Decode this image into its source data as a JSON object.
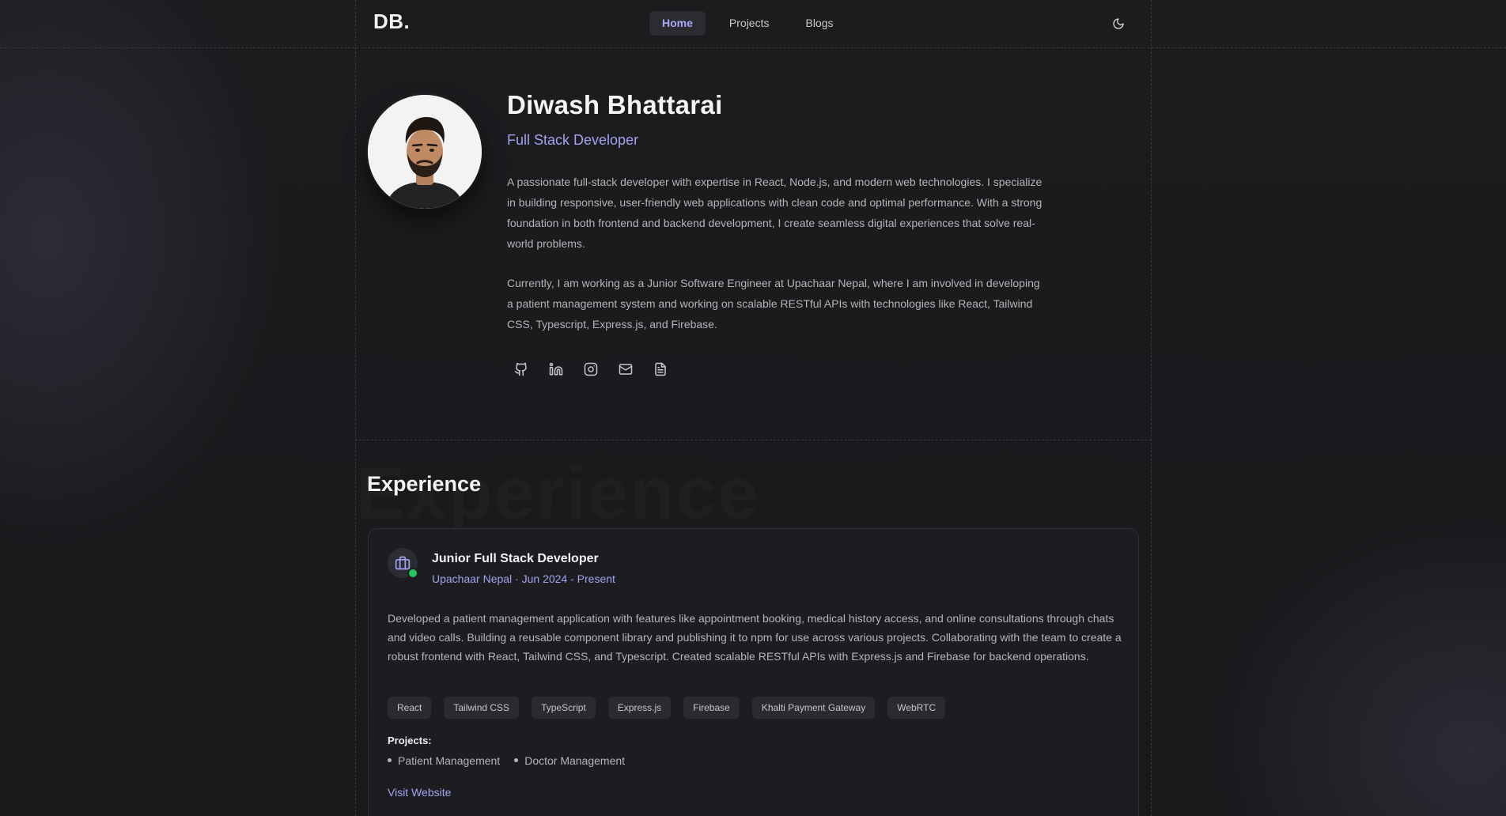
{
  "header": {
    "logo": "DB.",
    "nav": [
      {
        "label": "Home",
        "active": true
      },
      {
        "label": "Projects",
        "active": false
      },
      {
        "label": "Blogs",
        "active": false
      }
    ],
    "theme_toggle_icon": "moon-icon"
  },
  "hero": {
    "name": "Diwash Bhattarai",
    "role": "Full Stack Developer",
    "bio": [
      "A passionate full-stack developer with expertise in React, Node.js, and modern web technologies. I specialize in building responsive, user-friendly web applications with clean code and optimal performance. With a strong foundation in both frontend and backend development, I create seamless digital experiences that solve real-world problems.",
      "Currently, I am working as a Junior Software Engineer at Upachaar Nepal, where I am involved in developing a patient management system and working on scalable RESTful APIs with technologies like React, Tailwind CSS, Typescript, Express.js, and Firebase."
    ],
    "socials": [
      "github-icon",
      "linkedin-icon",
      "instagram-icon",
      "mail-icon",
      "resume-icon"
    ]
  },
  "experience": {
    "title": "Experience",
    "ghost_text": "Experience",
    "job": {
      "title": "Junior Full Stack Developer",
      "meta": "Upachaar Nepal · Jun 2024 - Present",
      "description": "Developed a patient management application with features like appointment booking, medical history access, and online consultations through chats and video calls. Building a reusable component library and publishing it to npm for use across various projects. Collaborating with the team to create a robust frontend with React, Tailwind CSS, and Typescript. Created scalable RESTful APIs with Express.js and Firebase for backend operations.",
      "tags": [
        "React",
        "Tailwind CSS",
        "TypeScript",
        "Express.js",
        "Firebase",
        "Khalti Payment Gateway",
        "WebRTC"
      ],
      "projects_label": "Projects:",
      "projects": [
        "Patient Management",
        "Doctor Management"
      ],
      "link_label": "Visit Website"
    }
  },
  "colors": {
    "accent": "#a3a2f2",
    "background": "#1b1b1e",
    "status": "#22c55e"
  }
}
